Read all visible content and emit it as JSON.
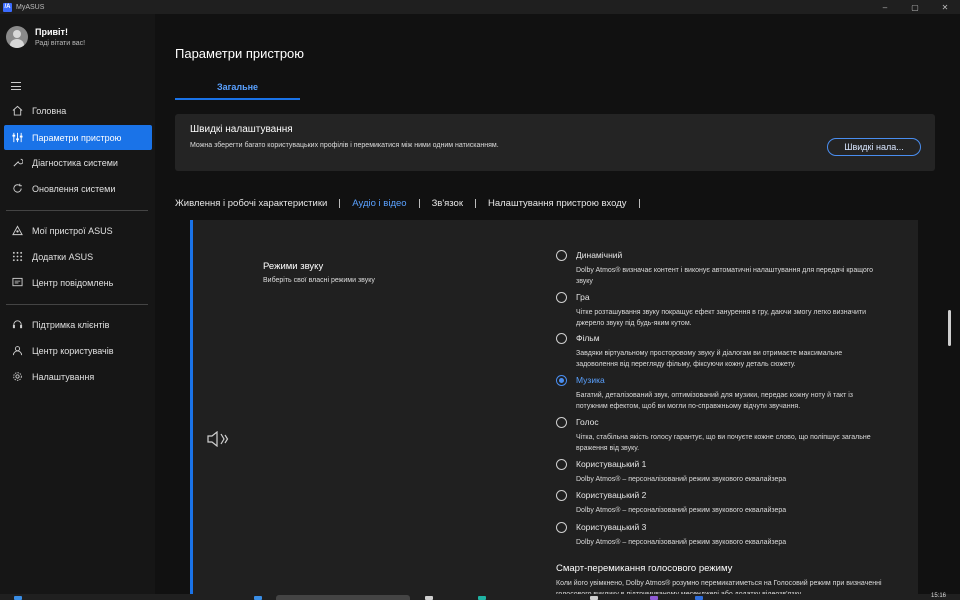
{
  "window": {
    "app_title": "MyASUS",
    "logo_text": "/A",
    "controls": [
      "–",
      "▢",
      "✕"
    ]
  },
  "sidebar": {
    "greeting": "Привіт!",
    "greeting_sub": "Раді вітати вас!",
    "items": [
      {
        "label": "Головна",
        "icon": "home-icon"
      },
      {
        "label": "Параметри пристрою",
        "icon": "sliders-icon",
        "active": true
      },
      {
        "label": "Діагностика системи",
        "icon": "wrench-icon"
      },
      {
        "label": "Оновлення системи",
        "icon": "refresh-icon"
      },
      {
        "label": "Мої пристрої ASUS",
        "icon": "triangle-icon"
      },
      {
        "label": "Додатки ASUS",
        "icon": "grid-icon"
      },
      {
        "label": "Центр повідомлень",
        "icon": "message-icon"
      },
      {
        "label": "Підтримка клієнтів",
        "icon": "headset-icon"
      },
      {
        "label": "Центр користувачів",
        "icon": "user-icon"
      },
      {
        "label": "Налаштування",
        "icon": "gear-icon"
      }
    ]
  },
  "main": {
    "page_title": "Параметри пристрою",
    "tab_general": "Загальне",
    "quick": {
      "title": "Швидкі налаштування",
      "desc": "Можна зберегти багато користувацьких профілів і перемикатися між ними одним натисканням.",
      "button": "Швидкі нала..."
    },
    "subtabs": [
      "Живлення і робочі характеристики",
      "Аудіо і відео",
      "Зв'язок",
      "Налаштування пристрою входу"
    ],
    "audio": {
      "title": "Режими звуку",
      "subtitle": "Виберіть свої власні режими звуку",
      "options": [
        {
          "label": "Динамічний",
          "desc": "Dolby Atmos® визначає контент і виконує автоматичні налаштування для передачі кращого звуку"
        },
        {
          "label": "Гра",
          "desc": "Чітке розташування звуку покращує ефект занурення в гру, даючи змогу легко визначити джерело звуку під будь-яким кутом."
        },
        {
          "label": "Фільм",
          "desc": "Завдяки віртуальному просторовому звуку й діалогам ви отримаєте максимальне задоволення від перегляду фільму, фіксуючи кожну деталь сюжету."
        },
        {
          "label": "Музика",
          "checked": true,
          "desc": "Багатий, деталізований звук, оптимізований для музики, передає кожну ноту й такт із потужним ефектом, щоб ви могли по-справжньому відчути звучання."
        },
        {
          "label": "Голос",
          "desc": "Чітка, стабільна якість голосу гарантує, що ви почуєте кожне слово, що поліпшує загальне враження від звуку."
        },
        {
          "label": "Користувацький 1",
          "desc": "Dolby Atmos® – персоналізований режим звукового еквалайзера"
        },
        {
          "label": "Користувацький 2",
          "desc": "Dolby Atmos® – персоналізований режим звукового еквалайзера"
        },
        {
          "label": "Користувацький 3",
          "desc": "Dolby Atmos® – персоналізований режим звукового еквалайзера"
        }
      ],
      "smart_title": "Смарт-перемикання голосового режиму",
      "smart_desc": "Коли його увімкнено, Dolby Atmos® розумно перемикатиметься на Голосовий режим при визначенні голосового виклику в підтримуваному месенджері або додатку відеозв'язку."
    }
  },
  "taskbar": {
    "time": "15:16"
  },
  "colors": {
    "accent": "#1a73e8",
    "accent_text": "#5aa1ff",
    "sidebar_bg": "#161616",
    "main_bg": "#111111",
    "card_bg": "#242424"
  }
}
